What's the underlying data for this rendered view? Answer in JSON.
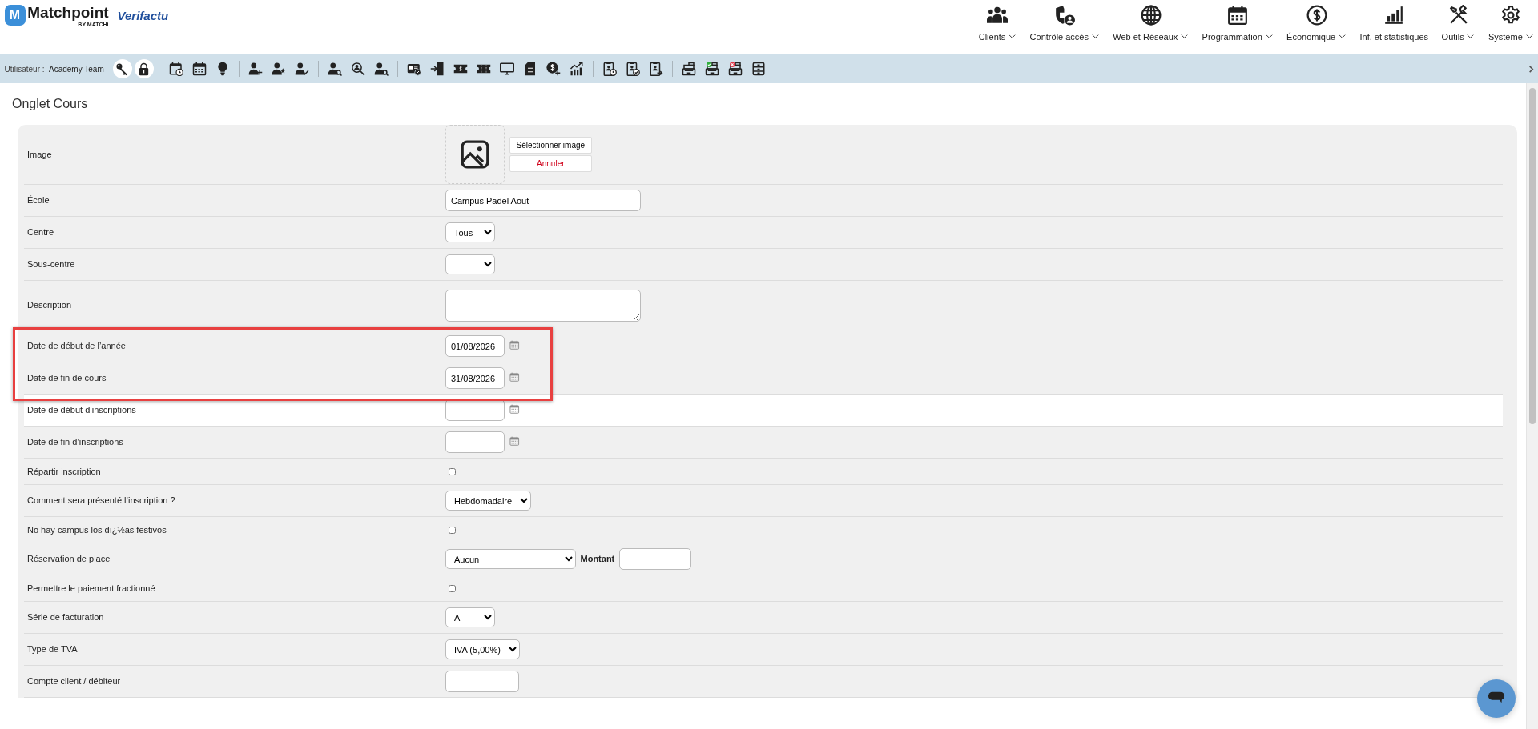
{
  "header": {
    "logo": {
      "mark": "M",
      "name": "Matchpoint",
      "tagline": "BY MATCHi"
    },
    "partner_logo": "Verifactu",
    "menus": [
      {
        "label": "Clients",
        "dropdown": true
      },
      {
        "label": "Contrôle accès",
        "dropdown": true
      },
      {
        "label": "Web et Réseaux",
        "dropdown": true
      },
      {
        "label": "Programmation",
        "dropdown": true
      },
      {
        "label": "Économique",
        "dropdown": true
      },
      {
        "label": "Inf. et statistiques",
        "dropdown": false
      },
      {
        "label": "Outils",
        "dropdown": true
      },
      {
        "label": "Système",
        "dropdown": true
      }
    ]
  },
  "toolbar": {
    "user_label": "Utilisateur :",
    "user_name": "Academy Team"
  },
  "page_title": "Onglet Cours",
  "form": {
    "rows": [
      {
        "kind": "image",
        "label": "Image",
        "select_button": "Sélectionner image",
        "cancel_button": "Annuler",
        "annotated": false,
        "highlighted": false
      },
      {
        "kind": "text",
        "label": "École",
        "value": "Campus Padel Aout",
        "annotated": false,
        "highlighted": false
      },
      {
        "kind": "select",
        "label": "Centre",
        "value": "Tous",
        "annotated": false,
        "highlighted": false
      },
      {
        "kind": "select",
        "label": "Sous-centre",
        "annotated": false,
        "highlighted": false
      },
      {
        "kind": "textarea",
        "label": "Description",
        "annotated": false,
        "highlighted": false
      },
      {
        "kind": "date",
        "label": "Date de début de l’année",
        "value": "01/08/2026",
        "annotated": true,
        "highlighted": false
      },
      {
        "kind": "date",
        "label": "Date de fin de cours",
        "value": "31/08/2026",
        "annotated": true,
        "highlighted": false
      },
      {
        "kind": "date",
        "label": "Date de début d’inscriptions",
        "annotated": false,
        "highlighted": true
      },
      {
        "kind": "date",
        "label": "Date de fin d’inscriptions",
        "annotated": false,
        "highlighted": false
      },
      {
        "kind": "checkbox",
        "label": "Répartir inscription",
        "checked": false,
        "annotated": false,
        "highlighted": false
      },
      {
        "kind": "select",
        "label": "Comment sera présenté l’inscription ?",
        "value": "Hebdomadaire",
        "annotated": false,
        "highlighted": false
      },
      {
        "kind": "checkbox",
        "label": "No hay campus los dï¿½as festivos",
        "checked": false,
        "annotated": false,
        "highlighted": false
      },
      {
        "kind": "select_amount",
        "label": "Réservation de place",
        "value": "Aucun",
        "amount_label": "Montant",
        "annotated": false,
        "highlighted": false
      },
      {
        "kind": "checkbox",
        "label": "Permettre le paiement fractionné",
        "checked": false,
        "annotated": false,
        "highlighted": false
      },
      {
        "kind": "select",
        "label": "Série de facturation",
        "value": "A-",
        "annotated": false,
        "highlighted": false
      },
      {
        "kind": "select",
        "label": "Type de TVA",
        "value": "IVA (5,00%)",
        "annotated": false,
        "highlighted": false
      },
      {
        "kind": "short_text",
        "label": "Compte client / débiteur",
        "annotated": false,
        "highlighted": false
      }
    ]
  }
}
